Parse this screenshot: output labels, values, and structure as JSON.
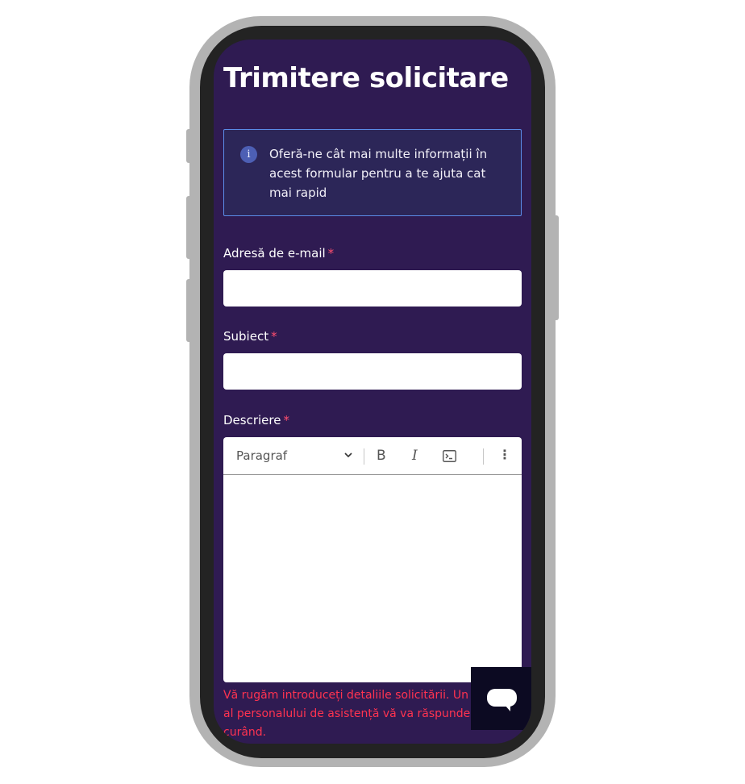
{
  "page": {
    "title": "Trimitere solicitare"
  },
  "info": {
    "icon": "info-icon",
    "icon_glyph": "i",
    "text": "Oferă-ne cât mai multe informații în acest formular pentru a te ajuta cat mai rapid"
  },
  "form": {
    "email": {
      "label": "Adresă de e-mail",
      "required": "*",
      "value": ""
    },
    "subject": {
      "label": "Subiect",
      "required": "*",
      "value": ""
    },
    "description": {
      "label": "Descriere",
      "required": "*",
      "toolbar": {
        "paragraph_select": "Paragraf",
        "bold_glyph": "B",
        "italic_glyph": "I",
        "code_icon": "code-block-icon",
        "more_glyph": "⋮"
      },
      "value": ""
    },
    "helper_text": "Vă rugăm introduceți detaliile solicitării. Un membru al personalului de asistență vă va răspunde cât mai curând."
  },
  "chat": {
    "icon": "chat-bubble-icon"
  },
  "colors": {
    "background": "#2f1b52",
    "info_border": "#5b8be8",
    "required": "#ff4f6f",
    "error": "#ff3350",
    "chat_button": "#0c0a22"
  }
}
